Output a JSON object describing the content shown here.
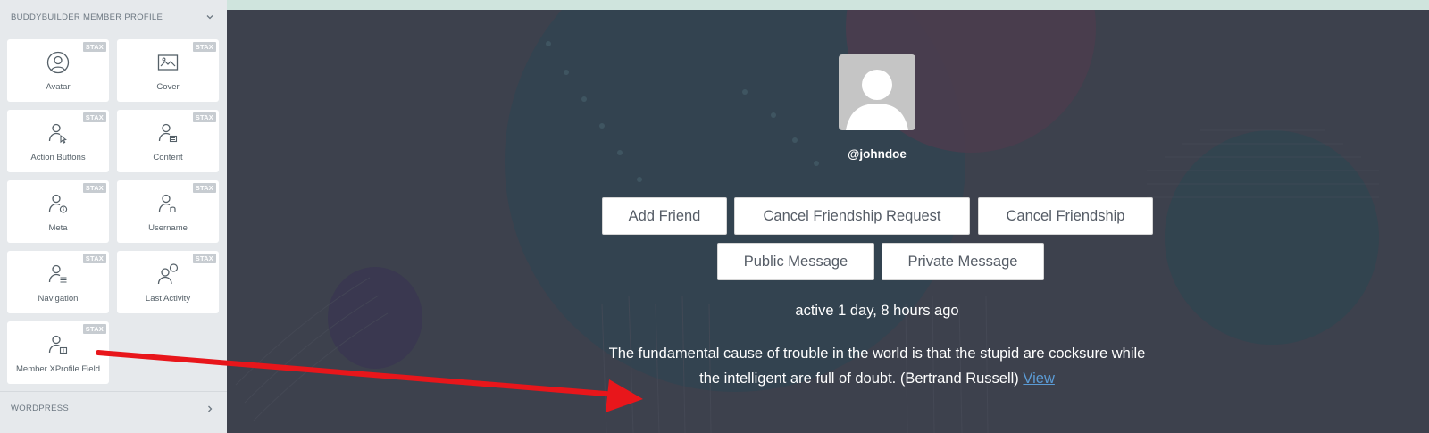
{
  "sidebar": {
    "section_title": "BUDDYBUILDER MEMBER PROFILE",
    "badge": "STAX",
    "widgets": [
      {
        "label": "Avatar",
        "icon": "avatar-icon"
      },
      {
        "label": "Cover",
        "icon": "cover-image-icon"
      },
      {
        "label": "Action Buttons",
        "icon": "user-pointer-icon"
      },
      {
        "label": "Content",
        "icon": "user-content-icon"
      },
      {
        "label": "Meta",
        "icon": "user-meta-icon"
      },
      {
        "label": "Username",
        "icon": "user-name-icon"
      },
      {
        "label": "Navigation",
        "icon": "user-navigation-icon"
      },
      {
        "label": "Last Activity",
        "icon": "user-activity-icon"
      },
      {
        "label": "Member XProfile Field",
        "icon": "user-field-icon"
      }
    ],
    "wordpress_title": "WORDPRESS"
  },
  "profile": {
    "username": "@johndoe",
    "buttons": {
      "add_friend": "Add Friend",
      "cancel_request": "Cancel Friendship Request",
      "cancel_friendship": "Cancel Friendship",
      "public_message": "Public Message",
      "private_message": "Private Message"
    },
    "last_active": "active 1 day, 8 hours ago",
    "quote_line1": "The fundamental cause of trouble in the world is that the stupid are cocksure while",
    "quote_line2": "the intelligent are full of doubt. (Bertrand Russell)",
    "view_link": "View"
  },
  "colors": {
    "preview_bg": "#3d414d",
    "link": "#5b9bd5",
    "arrow": "#e8161b",
    "top_strip": "#cfe4dd"
  }
}
